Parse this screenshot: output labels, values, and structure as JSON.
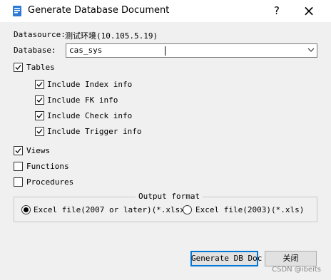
{
  "window": {
    "title": "Generate Database Document",
    "help_label": "?",
    "close_label": "×"
  },
  "datasource": {
    "label": "Datasource:",
    "value": "测试环境(10.105.5.19)"
  },
  "database": {
    "label": "Database:",
    "value": "cas_sys"
  },
  "tables": {
    "label": "Tables",
    "checked": true,
    "options": [
      {
        "label": "Include Index info",
        "checked": true
      },
      {
        "label": "Include FK info",
        "checked": true
      },
      {
        "label": "Include Check info",
        "checked": true
      },
      {
        "label": "Include Trigger info",
        "checked": true
      }
    ]
  },
  "views": {
    "label": "Views",
    "checked": true
  },
  "functions": {
    "label": "Functions",
    "checked": false
  },
  "procedures": {
    "label": "Procedures",
    "checked": false
  },
  "output_format": {
    "legend": "Output format",
    "options": [
      {
        "label": "Excel file(2007 or later)(*.xlsx)",
        "selected": true
      },
      {
        "label": "Excel file(2003)(*.xls)",
        "selected": false
      }
    ]
  },
  "buttons": {
    "generate": "Generate DB Doc",
    "close": "关闭"
  },
  "watermark": "CSDN @ibeits"
}
